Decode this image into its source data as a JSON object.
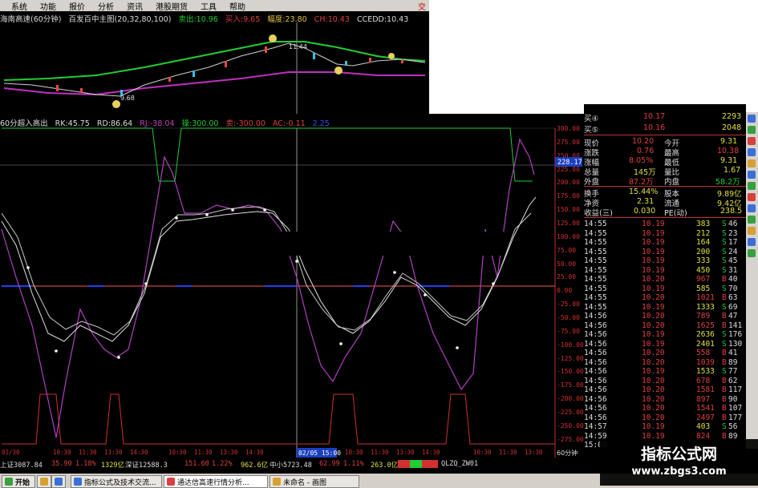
{
  "menu": [
    "系统",
    "功能",
    "报价",
    "分析",
    "资讯",
    "港股期货",
    "工具",
    "帮助"
  ],
  "close_glyph": "交",
  "price_title": {
    "name": "海南高速(60分钟)",
    "indicator": "百发百中主图(20,32,80,100)",
    "sell": "卖出:10.96",
    "buy": "买入:9.65",
    "amp": "幅度:23.80",
    "ch": "CH:10.43",
    "ccedd": "CCEDD:10.43",
    "label_a": "9.68",
    "label_b": "11.44"
  },
  "ind_title": {
    "name": "60分超入高出",
    "rk": "RK:45.75",
    "rd": "RD:86.64",
    "rj": "RJ:-38.04",
    "buy": "操:300.00",
    "sell": "卖:-300.00",
    "ac": "AC:-0.11",
    "extra": "2.25"
  },
  "y_axis": [
    "300.00",
    "275.00",
    "250.00",
    "225.00",
    "200.00",
    "175.00",
    "150.00",
    "125.00",
    "100.00",
    "75.00",
    "50.00",
    "25.00",
    "0.00",
    "-25.00",
    "-50.00",
    "-75.00",
    "-100.00",
    "-125.00",
    "-150.00",
    "-175.00",
    "-200.00",
    "-225.00",
    "-250.00",
    "-275.00"
  ],
  "price_tag": "228.17",
  "cursor_time": "02/05 15:00",
  "period_label": "60分钟",
  "x_labels": [
    "01/30",
    "10:30",
    "11:30",
    "13:30",
    "14:30",
    "10:30",
    "11:30",
    "13:30",
    "14:30",
    "10:30",
    "11:30",
    "13:30",
    "14:30",
    "10:30",
    "11:30",
    "13:30",
    "14:30",
    "10:30",
    "11:30",
    "13:30",
    "14:30"
  ],
  "quotes": [
    {
      "label": "买④",
      "v": "10.17",
      "v2": "2293"
    },
    {
      "label": "买⑤",
      "v": "10.16",
      "v2": "2048"
    }
  ],
  "stats": [
    {
      "l1": "现价",
      "v1": "10.20",
      "l2": "今开",
      "v2": "9.31"
    },
    {
      "l1": "涨跌",
      "v1": "0.76",
      "l2": "最高",
      "v2": "10.38"
    },
    {
      "l1": "涨幅",
      "v1": "8.05%",
      "l2": "最低",
      "v2": "9.31"
    },
    {
      "l1": "总量",
      "v1": "145万",
      "l2": "量比",
      "v2": "1.67"
    },
    {
      "l1": "外盘",
      "v1": "87.2万",
      "l2": "内盘",
      "v2": "58.2万"
    },
    {
      "l1": "换手",
      "v1": "15.44%",
      "l2": "股本",
      "v2": "9.89亿"
    },
    {
      "l1": "净资",
      "v1": "2.31",
      "l2": "流通",
      "v2": "9.42亿"
    },
    {
      "l1": "收益(三)",
      "v1": "0.030",
      "l2": "PE(动)",
      "v2": "238.5"
    }
  ],
  "ticks": [
    {
      "t": "14:55",
      "p": "10.19",
      "v": "383",
      "s": "S",
      "n": "46"
    },
    {
      "t": "14:55",
      "p": "10.19",
      "v": "212",
      "s": "S",
      "n": "23"
    },
    {
      "t": "14:55",
      "p": "10.19",
      "v": "164",
      "s": "S",
      "n": "17"
    },
    {
      "t": "14:55",
      "p": "10.19",
      "v": "200",
      "s": "S",
      "n": "24"
    },
    {
      "t": "14:55",
      "p": "10.19",
      "v": "333",
      "s": "S",
      "n": "45"
    },
    {
      "t": "14:55",
      "p": "10.19",
      "v": "450",
      "s": "S",
      "n": "31"
    },
    {
      "t": "14:55",
      "p": "10.20",
      "v": "967",
      "s": "B",
      "n": "40"
    },
    {
      "t": "14:55",
      "p": "10.19",
      "v": "585",
      "s": "S",
      "n": "70"
    },
    {
      "t": "14:55",
      "p": "10.20",
      "v": "1021",
      "s": "B",
      "n": "63"
    },
    {
      "t": "14:55",
      "p": "10.19",
      "v": "1333",
      "s": "S",
      "n": "69"
    },
    {
      "t": "14:56",
      "p": "10.20",
      "v": "789",
      "s": "B",
      "n": "47"
    },
    {
      "t": "14:56",
      "p": "10.20",
      "v": "1625",
      "s": "B",
      "n": "141"
    },
    {
      "t": "14:56",
      "p": "10.19",
      "v": "2636",
      "s": "S",
      "n": "176"
    },
    {
      "t": "14:56",
      "p": "10.19",
      "v": "2401",
      "s": "S",
      "n": "130"
    },
    {
      "t": "14:56",
      "p": "10.20",
      "v": "558",
      "s": "B",
      "n": "41"
    },
    {
      "t": "14:56",
      "p": "10.20",
      "v": "1039",
      "s": "B",
      "n": "89"
    },
    {
      "t": "14:56",
      "p": "10.19",
      "v": "1533",
      "s": "S",
      "n": "77"
    },
    {
      "t": "14:56",
      "p": "10.20",
      "v": "678",
      "s": "B",
      "n": "62"
    },
    {
      "t": "14:56",
      "p": "10.20",
      "v": "1581",
      "s": "B",
      "n": "117"
    },
    {
      "t": "14:56",
      "p": "10.20",
      "v": "897",
      "s": "B",
      "n": "90"
    },
    {
      "t": "14:56",
      "p": "10.20",
      "v": "1541",
      "s": "B",
      "n": "107"
    },
    {
      "t": "14:56",
      "p": "10.20",
      "v": "2497",
      "s": "B",
      "n": "177"
    },
    {
      "t": "14:57",
      "p": "10.19",
      "v": "403",
      "s": "S",
      "n": "56"
    },
    {
      "t": "14:59",
      "p": "10.19",
      "v": "824",
      "s": "B",
      "n": "89"
    },
    {
      "t": "15:00",
      "p": "",
      "v": "",
      "s": "",
      "n": ""
    }
  ],
  "status": {
    "sh": "上证3087.84",
    "sh_chg": "35.90",
    "sh_pct": "1.18%",
    "sh_amt": "1329亿",
    "sz": "深证12588.3",
    "sz_chg": "151.60",
    "sz_pct": "1.22%",
    "sz_amt": "962.6亿",
    "zx": "中小5723.48",
    "zx_chg": "62.99",
    "zx_pct": "1.11%",
    "zx_amt": "263.0亿",
    "code": "QLZQ_ZW01"
  },
  "taskbar": {
    "start": "开始",
    "item1": "指标公式及技术交流...",
    "item2": "通达信高速行情分析...",
    "item3": "未命名 - 画图"
  },
  "watermark": {
    "title": "指标公式网",
    "url": "www.zbgs3.com"
  }
}
